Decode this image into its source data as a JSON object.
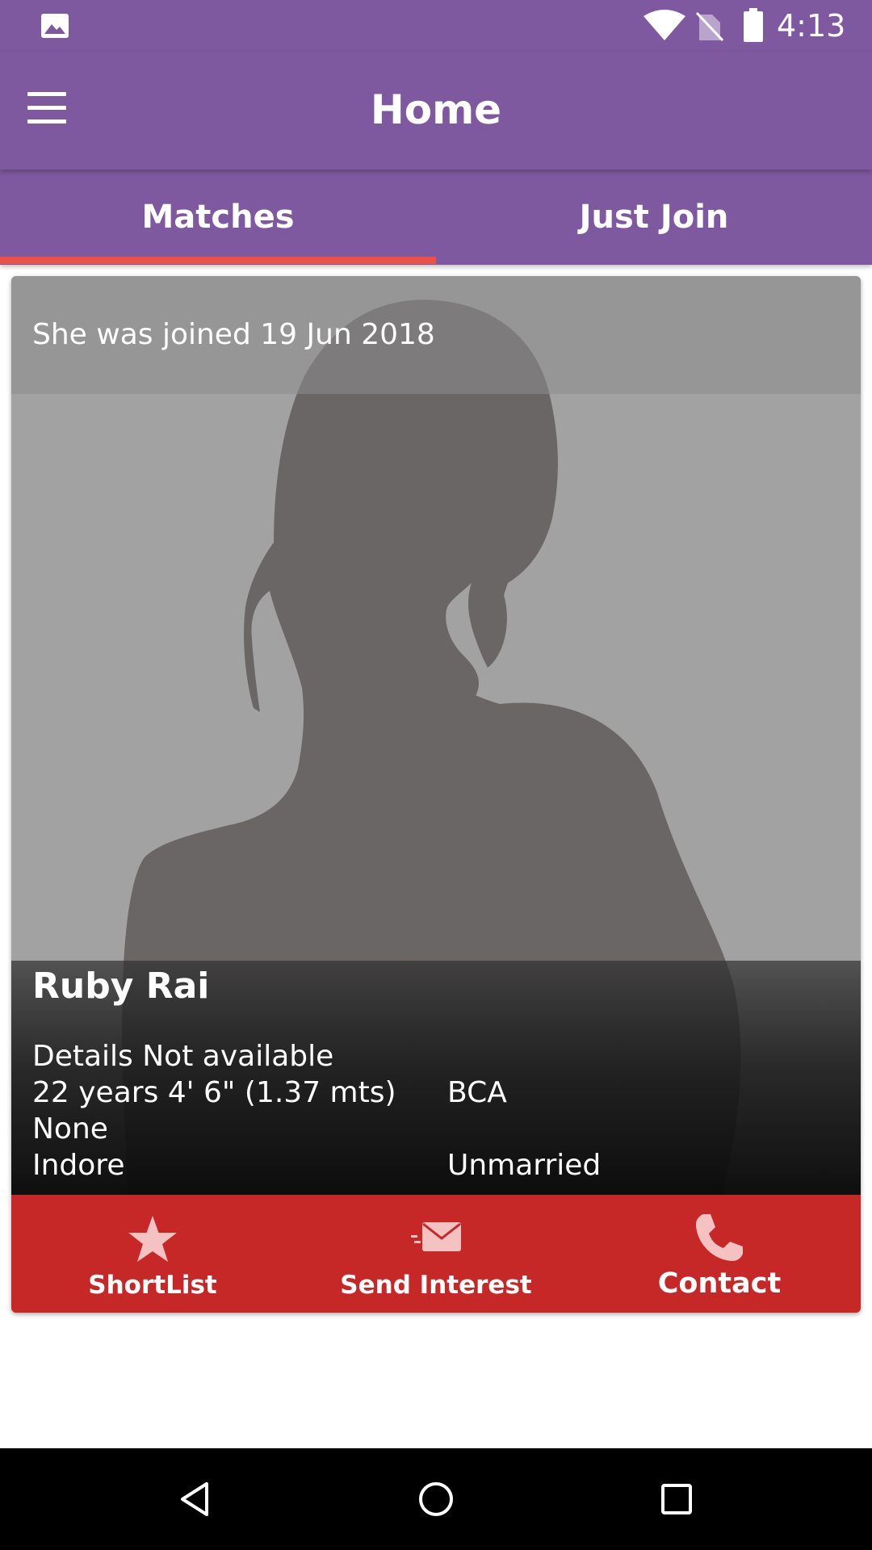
{
  "status_bar": {
    "time": "4:13"
  },
  "app_bar": {
    "title": "Home"
  },
  "tabs": [
    {
      "label": "Matches",
      "selected": true
    },
    {
      "label": "Just Join",
      "selected": false
    }
  ],
  "profile": {
    "joined": "She was joined 19 Jun 2018",
    "name": "Ruby Rai",
    "details": "Details Not available",
    "age_height": "22 years 4' 6\" (1.37 mts)",
    "education": "BCA",
    "extra": "None",
    "city": "Indore",
    "marital_status": "Unmarried"
  },
  "actions": {
    "shortlist": "ShortList",
    "send_interest": "Send Interest",
    "contact": "Contact"
  },
  "colors": {
    "primary": "#7f599f",
    "tab_indicator": "#ec5047",
    "action_bar": "#c62828",
    "icon_pink": "#f5c2c2"
  }
}
